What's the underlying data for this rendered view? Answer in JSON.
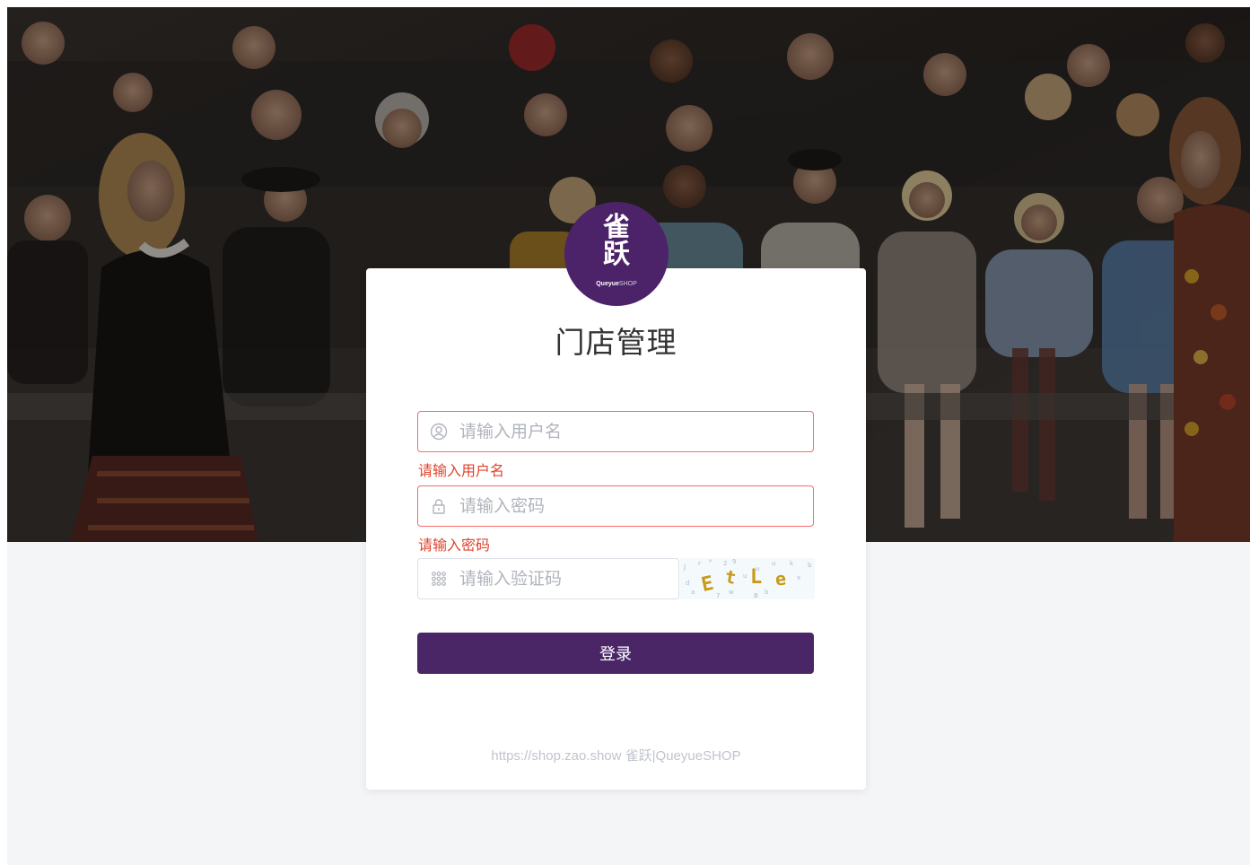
{
  "brand": {
    "logo_mark_line1": "雀",
    "logo_mark_line2": "跃",
    "logo_wordmark": "Queyue",
    "logo_wordmark_suffix": "SHOP",
    "color": "#4c2369"
  },
  "login": {
    "title": "门店管理",
    "username": {
      "value": "",
      "placeholder": "请输入用户名",
      "error": "请输入用户名",
      "icon": "user-icon"
    },
    "password": {
      "value": "",
      "placeholder": "请输入密码",
      "error": "请输入密码",
      "icon": "lock-icon"
    },
    "captcha": {
      "value": "",
      "placeholder": "请输入验证码",
      "icon": "keypad-icon",
      "image_text": "EtLe"
    },
    "submit_label": "登录",
    "button_color": "#4a2667",
    "error_color": "#e0432c"
  },
  "footer": {
    "text": "https://shop.zao.show 雀跃|QueyueSHOP"
  }
}
